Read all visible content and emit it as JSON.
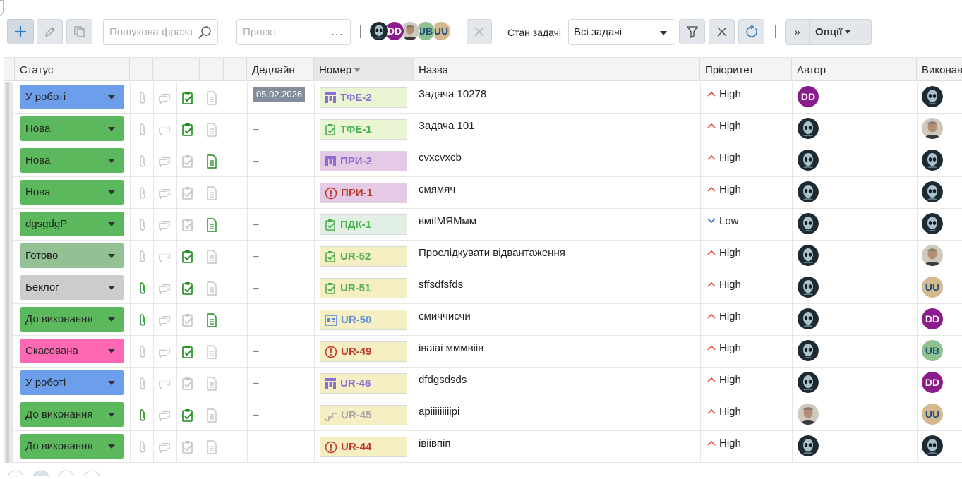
{
  "toolbar": {
    "search_placeholder": "Пошукова фраза",
    "project_placeholder": "Проєкт",
    "project_dots": "...",
    "user_filter": [
      {
        "kind": "alien"
      },
      {
        "kind": "initials",
        "initials": "DD",
        "bg": "#8a1c8c",
        "fg": "#ffffff"
      },
      {
        "kind": "photo"
      },
      {
        "kind": "initials",
        "initials": "UB",
        "bg": "#8fc18f",
        "fg": "#1d4f7a"
      },
      {
        "kind": "initials",
        "initials": "UU",
        "bg": "#d4b98f",
        "fg": "#1d4f7a"
      }
    ],
    "state_label": "Стан задачі",
    "state_value": "Всі задачі",
    "options_chevron": "»",
    "options_label": "Опції"
  },
  "columns": {
    "status": "Статус",
    "deadline": "Дедлайн",
    "number": "Номер",
    "title": "Назва",
    "priority": "Пріоритет",
    "author": "Автор",
    "assignee": "Виконавець"
  },
  "colors": {
    "status_in_progress": "#6d9eeb",
    "status_new": "#5cb85c",
    "status_done": "#93c193",
    "status_backlog": "#cccccc",
    "status_cancelled": "#ff69b4",
    "prio_high": "#e05a4a",
    "prio_low": "#3b74c9",
    "attach_active": "#1a8a1a",
    "icon_inactive": "#c4c4c4"
  },
  "rows": [
    {
      "status": "У роботі",
      "status_color": "#6d9eeb",
      "attach": false,
      "checklist": true,
      "doc": false,
      "deadline": "05.02.2026",
      "number": "ТФЕ-2",
      "num_icon": "kanban-icon",
      "num_bg": "#eaf5d3",
      "num_color": "#8a6fd1",
      "title": "Задача 10278",
      "priority": "High",
      "author": {
        "kind": "initials",
        "initials": "DD",
        "bg": "#8a1c8c",
        "fg": "#ffffff"
      },
      "assignee": {
        "kind": "alien"
      }
    },
    {
      "status": "Нова",
      "status_color": "#5cb85c",
      "attach": false,
      "checklist": true,
      "doc": false,
      "deadline": "–",
      "number": "ТФЕ-1",
      "num_icon": "task-icon",
      "num_bg": "#eaf5d3",
      "num_color": "#4caf50",
      "title": "Задача 101",
      "priority": "High",
      "author": {
        "kind": "alien"
      },
      "assignee": {
        "kind": "photo"
      }
    },
    {
      "status": "Нова",
      "status_color": "#5cb85c",
      "attach": false,
      "checklist": false,
      "doc": true,
      "deadline": "–",
      "number": "ПРИ-2",
      "num_icon": "kanban-icon",
      "num_bg": "#e4cae4",
      "num_color": "#8a6fd1",
      "title": "cvxcvxcb",
      "priority": "High",
      "author": {
        "kind": "alien"
      },
      "assignee": {
        "kind": "alien"
      }
    },
    {
      "status": "Нова",
      "status_color": "#5cb85c",
      "attach": false,
      "checklist": false,
      "doc": false,
      "deadline": "–",
      "number": "ПРИ-1",
      "num_icon": "warning-icon",
      "num_bg": "#e4cae4",
      "num_color": "#c0392b",
      "title": "смямяч",
      "priority": "High",
      "author": {
        "kind": "alien"
      },
      "assignee": {
        "kind": "alien"
      }
    },
    {
      "status": "dgsgdgP",
      "status_color": "#5cb85c",
      "attach": false,
      "checklist": false,
      "doc": true,
      "deadline": "–",
      "number": "ПДК-1",
      "num_icon": "task-icon",
      "num_bg": "#e2efe4",
      "num_color": "#4caf50",
      "title": "вміІМЯМмм",
      "priority": "Low",
      "author": {
        "kind": "alien"
      },
      "assignee": {
        "kind": "alien"
      }
    },
    {
      "status": "Готово",
      "status_color": "#93c193",
      "attach": false,
      "checklist": true,
      "doc": false,
      "deadline": "–",
      "number": "UR-52",
      "num_icon": "task-icon",
      "num_bg": "#f7efc4",
      "num_color": "#4caf50",
      "title": "Прослідкувати відвантаження",
      "priority": "High",
      "author": {
        "kind": "alien"
      },
      "assignee": {
        "kind": "photo"
      }
    },
    {
      "status": "Беклог",
      "status_color": "#cccccc",
      "attach": true,
      "checklist": true,
      "doc": false,
      "deadline": "–",
      "number": "UR-51",
      "num_icon": "task-icon",
      "num_bg": "#f7efc4",
      "num_color": "#4caf50",
      "title": "sffsdfsfds",
      "priority": "High",
      "author": {
        "kind": "alien"
      },
      "assignee": {
        "kind": "initials",
        "initials": "UU",
        "bg": "#d4b98f",
        "fg": "#1d4f7a"
      }
    },
    {
      "status": "До виконання",
      "status_color": "#5cb85c",
      "attach": true,
      "checklist": false,
      "doc": true,
      "deadline": "–",
      "number": "UR-50",
      "num_icon": "board-icon",
      "num_bg": "#f7efc4",
      "num_color": "#5b8dd6",
      "title": "смиччисчи",
      "priority": "High",
      "author": {
        "kind": "alien"
      },
      "assignee": {
        "kind": "initials",
        "initials": "DD",
        "bg": "#8a1c8c",
        "fg": "#ffffff"
      }
    },
    {
      "status": "Скасована",
      "status_color": "#ff69b4",
      "attach": false,
      "checklist": true,
      "doc": false,
      "deadline": "–",
      "number": "UR-49",
      "num_icon": "warning-icon",
      "num_bg": "#f7efc4",
      "num_color": "#c0392b",
      "title": "іваіаі мммвіів",
      "priority": "High",
      "author": {
        "kind": "alien"
      },
      "assignee": {
        "kind": "initials",
        "initials": "UB",
        "bg": "#8fc18f",
        "fg": "#1d4f7a"
      }
    },
    {
      "status": "У роботі",
      "status_color": "#6d9eeb",
      "attach": false,
      "checklist": false,
      "doc": false,
      "deadline": "–",
      "number": "UR-46",
      "num_icon": "kanban-icon",
      "num_bg": "#f7efc4",
      "num_color": "#8a6fd1",
      "title": "dfdgsdsds",
      "priority": "High",
      "author": {
        "kind": "alien"
      },
      "assignee": {
        "kind": "initials",
        "initials": "DD",
        "bg": "#8a1c8c",
        "fg": "#ffffff"
      }
    },
    {
      "status": "До виконання",
      "status_color": "#5cb85c",
      "attach": true,
      "checklist": true,
      "doc": false,
      "deadline": "–",
      "number": "UR-45",
      "num_icon": "steps-icon",
      "num_bg": "#f7efc4",
      "num_color": "#a8a8a8",
      "title": "apiiiiiiiiipi",
      "priority": "High",
      "author": {
        "kind": "photo"
      },
      "assignee": {
        "kind": "initials",
        "initials": "UU",
        "bg": "#d4b98f",
        "fg": "#1d4f7a"
      }
    },
    {
      "status": "До виконання",
      "status_color": "#5cb85c",
      "attach": false,
      "checklist": false,
      "doc": false,
      "deadline": "–",
      "number": "UR-44",
      "num_icon": "warning-icon",
      "num_bg": "#f7efc4",
      "num_color": "#c0392b",
      "title": "івіівпіп",
      "priority": "High",
      "author": {
        "kind": "alien"
      },
      "assignee": {
        "kind": "alien"
      }
    }
  ]
}
